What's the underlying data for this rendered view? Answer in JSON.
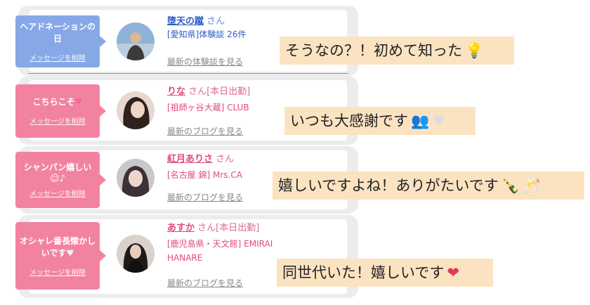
{
  "rows": [
    {
      "message": "ヘアドネーションの日",
      "delete_label": "メッセージを削除",
      "name": "堕天の蹴",
      "suffix": "さん",
      "detail1": "[愛知県]体験談 26件",
      "detail2": "",
      "more": "最新の体験談を見る",
      "caption": "そうなの？！初めて知った"
    },
    {
      "message": "こちらこそ",
      "delete_label": "メッセージを削除",
      "name": "りな",
      "suffix": "さん[本日出勤]",
      "detail1": "[祖師ヶ谷大蔵] CLUB",
      "detail2": "",
      "more": "最新のブログを見る",
      "caption": "いつも大感謝です"
    },
    {
      "message": "シャンパン嬉しい",
      "delete_label": "メッセージを削除",
      "name": "紅月ありさ",
      "suffix": "さん",
      "detail1": "[名古屋 錦] Mrs.CA",
      "detail2": "",
      "more": "最新のブログを見る",
      "caption": "嬉しいですよね！ありがたいです"
    },
    {
      "message": "オシャレ番長懐かしいです",
      "delete_label": "メッセージを削除",
      "name": "あすか",
      "suffix": "さん[本日出勤]",
      "detail1": "[鹿児島県・天文館] EMIRAI",
      "detail2": "HANARE",
      "more": "最新のブログを見る",
      "caption": "同世代いた！嬉しいです"
    }
  ],
  "colors": {
    "message_blue": "#86a8e6",
    "message_pink": "#f283a0",
    "caption_bg": "#fbe3c2"
  }
}
